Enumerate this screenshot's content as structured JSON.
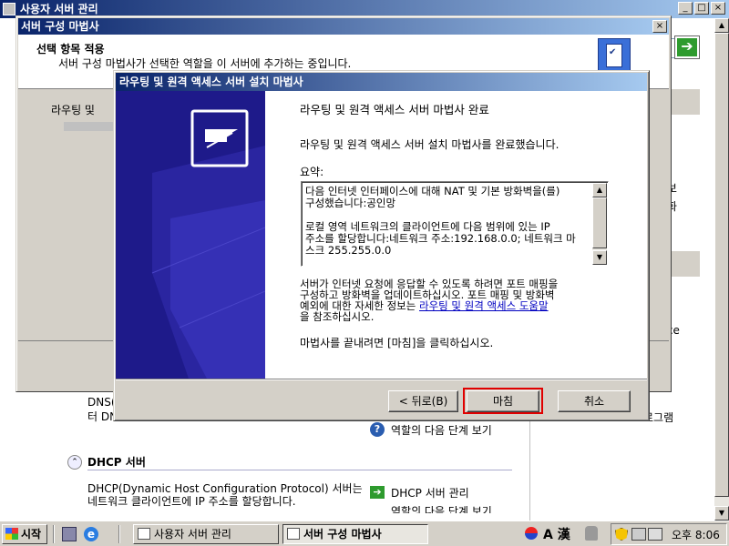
{
  "bg_window": {
    "title": "사용자 서버 관리",
    "caption_buttons": {
      "minimize": "_",
      "maximize": "□",
      "close": "×"
    },
    "right_bar_partial": ")",
    "right_text_1": "를 정보",
    "right_text_2": "안 강화",
    "right_text_3": "source",
    "right_text_4": "리티",
    "right_text_5": "로그램",
    "dns_partial_1": "DNS(",
    "dns_partial_2": "터 DN",
    "next_steps_link": "역할의 다음 단계 보기",
    "dhcp_heading": "DHCP 서버",
    "dhcp_desc_1": "DHCP(Dynamic Host Configuration Protocol) 서버는",
    "dhcp_desc_2": "네트워크 클라이언트에 IP 주소를 할당합니다.",
    "dhcp_manage_link": "DHCP 서버 관리",
    "dhcp_next_partial": "역할의 다음 단계 보기"
  },
  "wizard": {
    "title": "서버 구성 마법사",
    "close_glyph": "×",
    "header_title": "선택 항목 적용",
    "header_desc": "서버 구성 마법사가 선택한 역할을 이 서버에 추가하는 중입니다.",
    "left_label": "라우팅 및"
  },
  "dialog": {
    "title": "라우팅 및 원격 액세스 서버 설치 마법사",
    "heading": "라우팅 및 원격 액세스 서버 마법사 완료",
    "subtitle": "라우팅 및 원격 액세스 서버 설치 마법사를 완료했습니다.",
    "summary_label": "요약:",
    "summary_text": "다음 인터넷 인터페이스에 대해 NAT 및 기본 방화벽을(를)\n구성했습니다:공인망\n\n로컬 영역 네트워크의 클라이언트에 다음 범위에 있는 IP\n주소를 할당합니다:네트워크 주소:192.168.0.0; 네트워크 마\n스크 255.255.0.0",
    "info_text_1": "서버가 인터넷 요청에 응답할 수 있도록 하려면 포트 매핑을",
    "info_text_2": "구성하고 방화벽을 업데이트하십시오. 포트 매핑 및 방화벽",
    "info_text_3_pre": "예외에 대한 자세한 정보는 ",
    "info_link": "라우팅 및 원격 액세스 도움말",
    "info_text_4": "을 참조하십시오.",
    "finish_hint": "마법사를 끝내려면 [마침]을 클릭하십시오.",
    "buttons": {
      "back": "< 뒤로(B)",
      "finish": "마침",
      "cancel": "취소"
    },
    "highlight_color": "#e00000"
  },
  "taskbar": {
    "start": "시작",
    "tasks": [
      {
        "label": "사용자 서버 관리",
        "active": false
      },
      {
        "label": "서버 구성 마법사",
        "active": true
      }
    ],
    "tray_ime": "A 漢",
    "clock": "오후 8:06"
  }
}
